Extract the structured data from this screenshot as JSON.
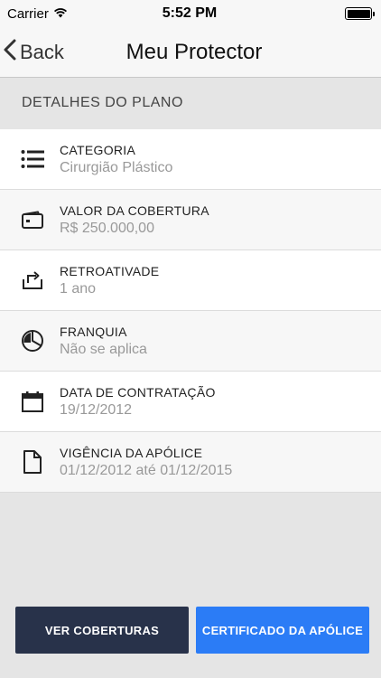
{
  "status_bar": {
    "carrier": "Carrier",
    "time": "5:52 PM"
  },
  "nav": {
    "back_label": "Back",
    "title": "Meu Protector"
  },
  "section": {
    "title": "DETALHES DO PLANO"
  },
  "details": [
    {
      "label": "CATEGORIA",
      "value": "Cirurgião Plástico",
      "icon": "list-icon"
    },
    {
      "label": "VALOR DA COBERTURA",
      "value": "R$ 250.000,00",
      "icon": "wallet-icon"
    },
    {
      "label": "RETROATIVADE",
      "value": "1 ano",
      "icon": "retroactive-arrow-icon"
    },
    {
      "label": "FRANQUIA",
      "value": "Não se aplica",
      "icon": "pie-chart-icon"
    },
    {
      "label": "DATA DE CONTRATAÇÃO",
      "value": "19/12/2012",
      "icon": "calendar-icon"
    },
    {
      "label": "VIGÊNCIA DA APÓLICE",
      "value": "01/12/2012 até 01/12/2015",
      "icon": "document-icon"
    }
  ],
  "buttons": {
    "coverages": "VER COBERTURAS",
    "certificate": "CERTIFICADO DA APÓLICE"
  },
  "colors": {
    "dark_button": "#28324a",
    "blue_button": "#2b7cf6"
  }
}
